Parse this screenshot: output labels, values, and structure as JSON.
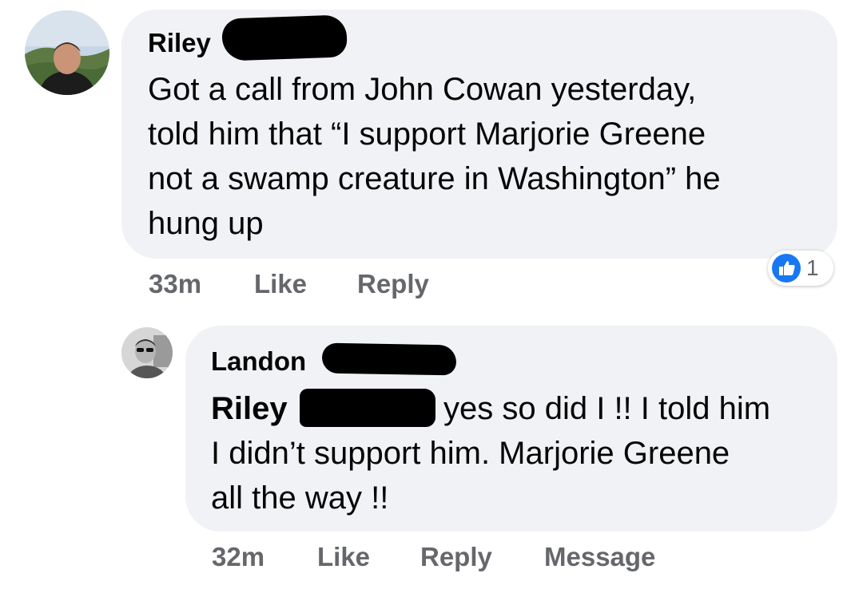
{
  "comment": {
    "author_first": "Riley",
    "text_lines": [
      "Got a call from John Cowan yesterday,",
      "told him that “I support Marjorie Greene",
      "not a swamp creature in Washington” he",
      "hung up"
    ],
    "time": "33m",
    "like_label": "Like",
    "reply_label": "Reply",
    "reaction_icon": "like-icon",
    "reaction_count": "1",
    "colors": {
      "bubble": "#f0f2f5",
      "like_blue": "#1877f2",
      "meta": "#65676b"
    }
  },
  "reply": {
    "author_first": "Landon",
    "mention_first": "Riley",
    "text_lines": [
      "yes so did I !! I told him",
      "I didn’t support him. Marjorie Greene",
      "all the way !!"
    ],
    "time": "32m",
    "like_label": "Like",
    "reply_label": "Reply",
    "message_label": "Message"
  }
}
